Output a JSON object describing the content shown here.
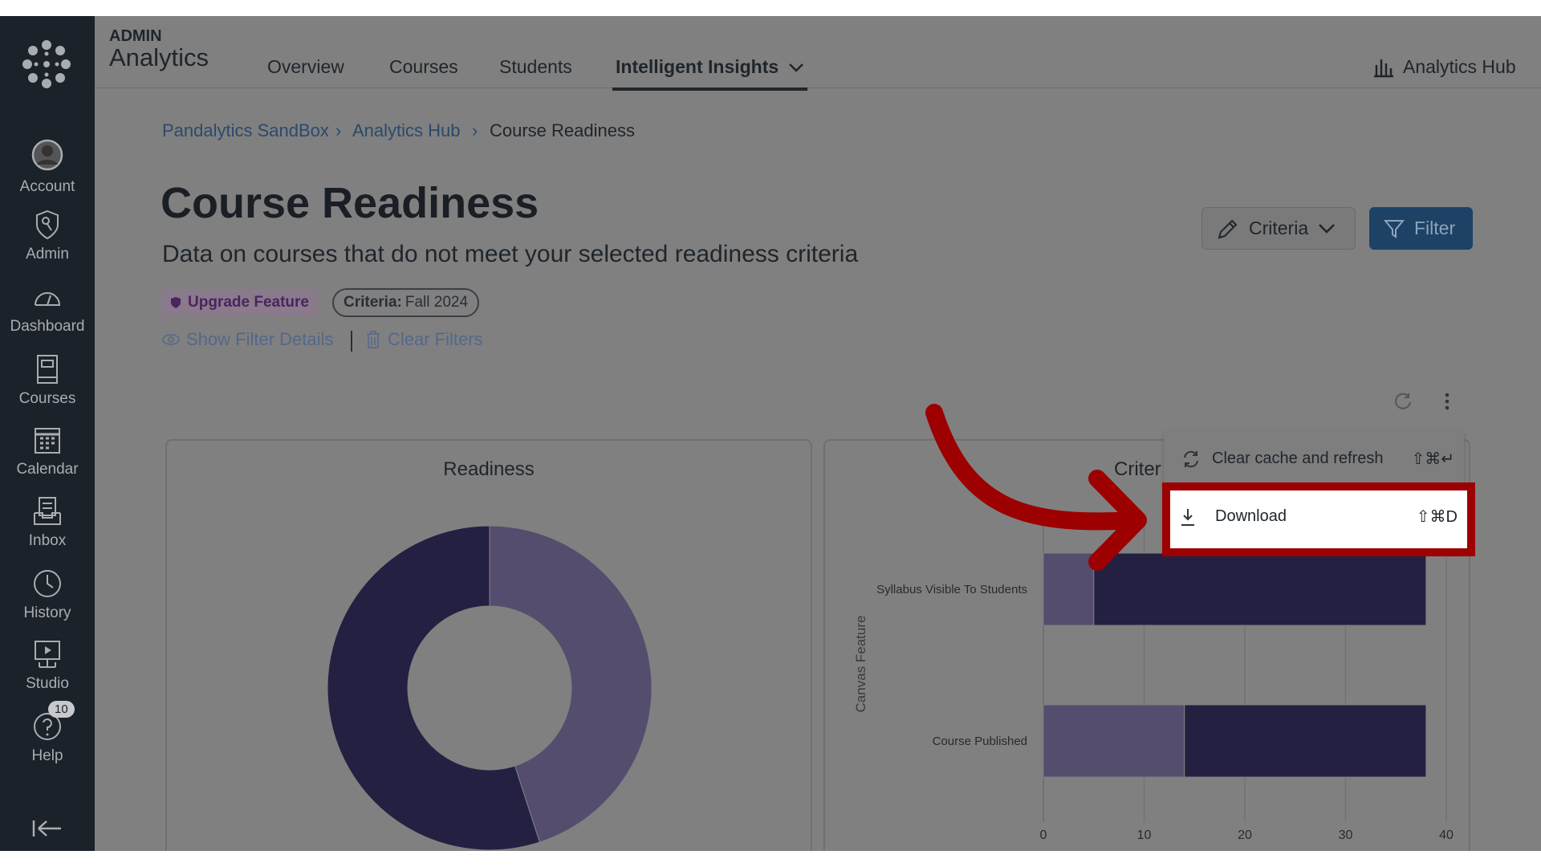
{
  "sidebar": {
    "items": [
      {
        "label": "Account",
        "icon": "user-avatar-icon"
      },
      {
        "label": "Admin",
        "icon": "shield-key-icon"
      },
      {
        "label": "Dashboard",
        "icon": "speedometer-icon"
      },
      {
        "label": "Courses",
        "icon": "book-icon"
      },
      {
        "label": "Calendar",
        "icon": "calendar-icon"
      },
      {
        "label": "Inbox",
        "icon": "inbox-icon"
      },
      {
        "label": "History",
        "icon": "clock-icon"
      },
      {
        "label": "Studio",
        "icon": "studio-icon"
      },
      {
        "label": "Help",
        "icon": "help-icon",
        "badge": "10"
      }
    ]
  },
  "header": {
    "eyebrow": "ADMIN",
    "title": "Analytics",
    "nav": [
      "Overview",
      "Courses",
      "Students",
      "Intelligent Insights"
    ],
    "active_nav": "Intelligent Insights",
    "hub_link": "Analytics Hub"
  },
  "breadcrumb": [
    "Pandalytics SandBox",
    "Analytics Hub",
    "Course Readiness"
  ],
  "page": {
    "title": "Course Readiness",
    "subtitle": "Data on courses that do not meet your selected readiness criteria",
    "upgrade_badge": "Upgrade Feature",
    "criteria_label": "Criteria:",
    "criteria_value": "Fall 2024",
    "show_filter": "Show Filter Details",
    "clear_filters": "Clear Filters",
    "criteria_button": "Criteria",
    "filter_button": "Filter"
  },
  "menu": {
    "items": [
      {
        "label": "Clear cache and refresh",
        "shortcut": "⇧⌘↵"
      },
      {
        "label": "Download",
        "shortcut": "⇧⌘D"
      }
    ]
  },
  "colors": {
    "dark_series": "#242042",
    "light_series": "#554d6e",
    "accent": "#2d5b8a",
    "annotation": "#9c0000"
  },
  "chart_data": [
    {
      "type": "pie",
      "title": "Readiness",
      "values": [
        45,
        55
      ],
      "colors": [
        "#554d6e",
        "#242042"
      ]
    },
    {
      "type": "bar",
      "orientation": "horizontal",
      "stacked": true,
      "title": "Criter",
      "ylabel": "Canvas Feature",
      "categories": [
        "Syllabus Visible To Students",
        "Course Published"
      ],
      "series": [
        {
          "values": [
            5,
            14
          ],
          "color": "#554d6e"
        },
        {
          "values": [
            33,
            24
          ],
          "color": "#242042"
        }
      ],
      "xlim": [
        0,
        40
      ],
      "xticks": [
        "0",
        "10",
        "20",
        "30",
        "40"
      ],
      "grid": true
    }
  ]
}
